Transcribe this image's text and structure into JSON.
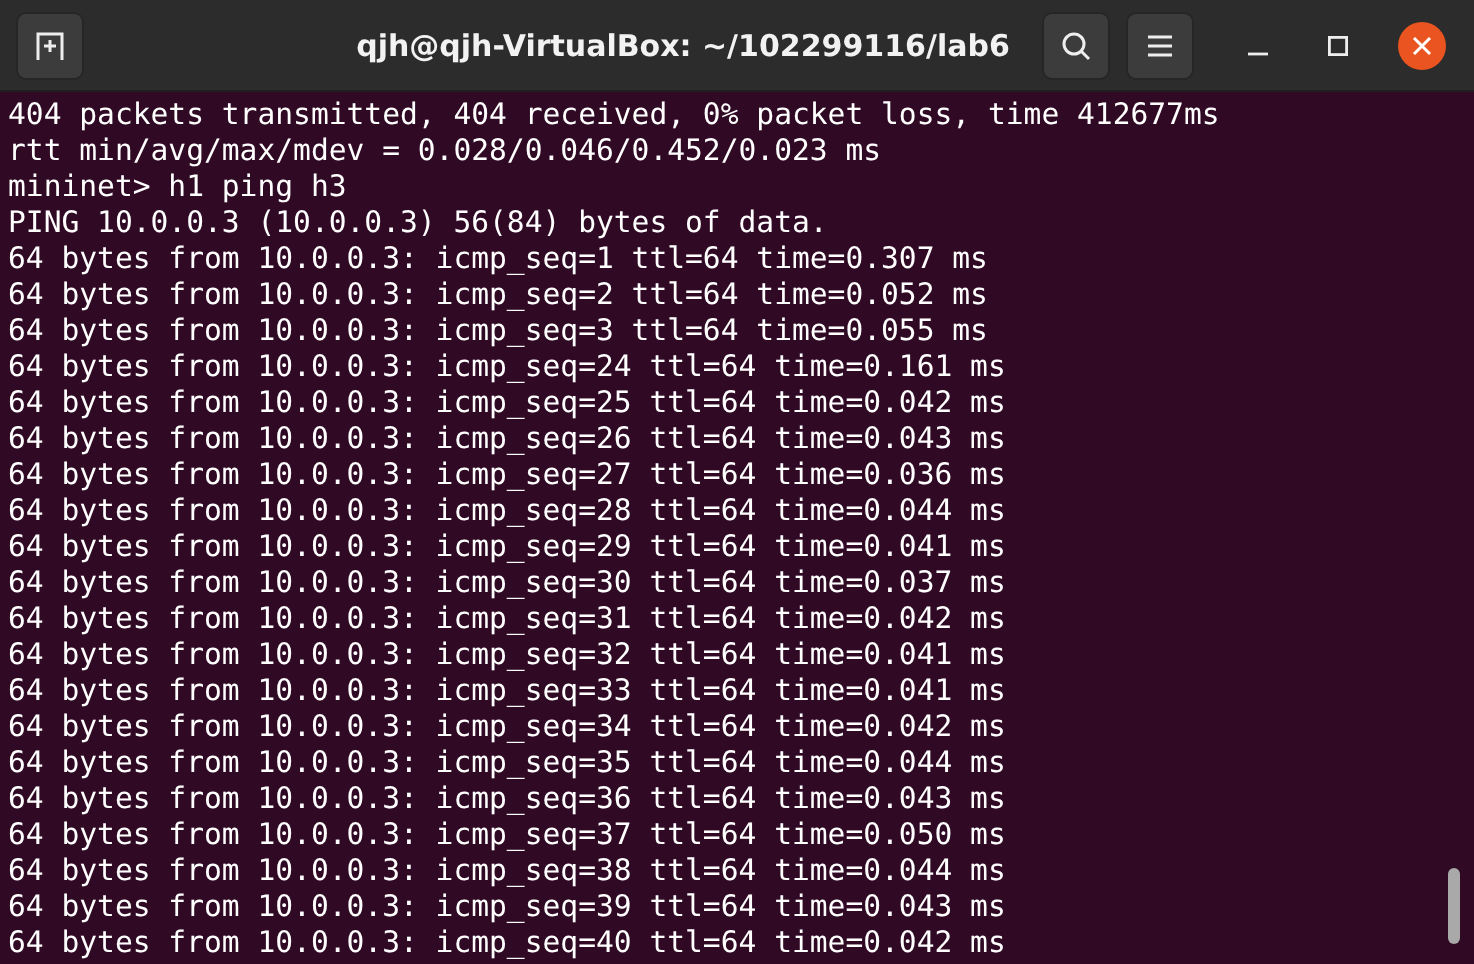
{
  "window": {
    "title": "qjh@qjh-VirtualBox: ~/102299116/lab6"
  },
  "terminal": {
    "lines": [
      "404 packets transmitted, 404 received, 0% packet loss, time 412677ms",
      "rtt min/avg/max/mdev = 0.028/0.046/0.452/0.023 ms",
      "mininet> h1 ping h3",
      "PING 10.0.0.3 (10.0.0.3) 56(84) bytes of data.",
      "64 bytes from 10.0.0.3: icmp_seq=1 ttl=64 time=0.307 ms",
      "64 bytes from 10.0.0.3: icmp_seq=2 ttl=64 time=0.052 ms",
      "64 bytes from 10.0.0.3: icmp_seq=3 ttl=64 time=0.055 ms",
      "64 bytes from 10.0.0.3: icmp_seq=24 ttl=64 time=0.161 ms",
      "64 bytes from 10.0.0.3: icmp_seq=25 ttl=64 time=0.042 ms",
      "64 bytes from 10.0.0.3: icmp_seq=26 ttl=64 time=0.043 ms",
      "64 bytes from 10.0.0.3: icmp_seq=27 ttl=64 time=0.036 ms",
      "64 bytes from 10.0.0.3: icmp_seq=28 ttl=64 time=0.044 ms",
      "64 bytes from 10.0.0.3: icmp_seq=29 ttl=64 time=0.041 ms",
      "64 bytes from 10.0.0.3: icmp_seq=30 ttl=64 time=0.037 ms",
      "64 bytes from 10.0.0.3: icmp_seq=31 ttl=64 time=0.042 ms",
      "64 bytes from 10.0.0.3: icmp_seq=32 ttl=64 time=0.041 ms",
      "64 bytes from 10.0.0.3: icmp_seq=33 ttl=64 time=0.041 ms",
      "64 bytes from 10.0.0.3: icmp_seq=34 ttl=64 time=0.042 ms",
      "64 bytes from 10.0.0.3: icmp_seq=35 ttl=64 time=0.044 ms",
      "64 bytes from 10.0.0.3: icmp_seq=36 ttl=64 time=0.043 ms",
      "64 bytes from 10.0.0.3: icmp_seq=37 ttl=64 time=0.050 ms",
      "64 bytes from 10.0.0.3: icmp_seq=38 ttl=64 time=0.044 ms",
      "64 bytes from 10.0.0.3: icmp_seq=39 ttl=64 time=0.043 ms",
      "64 bytes from 10.0.0.3: icmp_seq=40 ttl=64 time=0.042 ms"
    ]
  }
}
